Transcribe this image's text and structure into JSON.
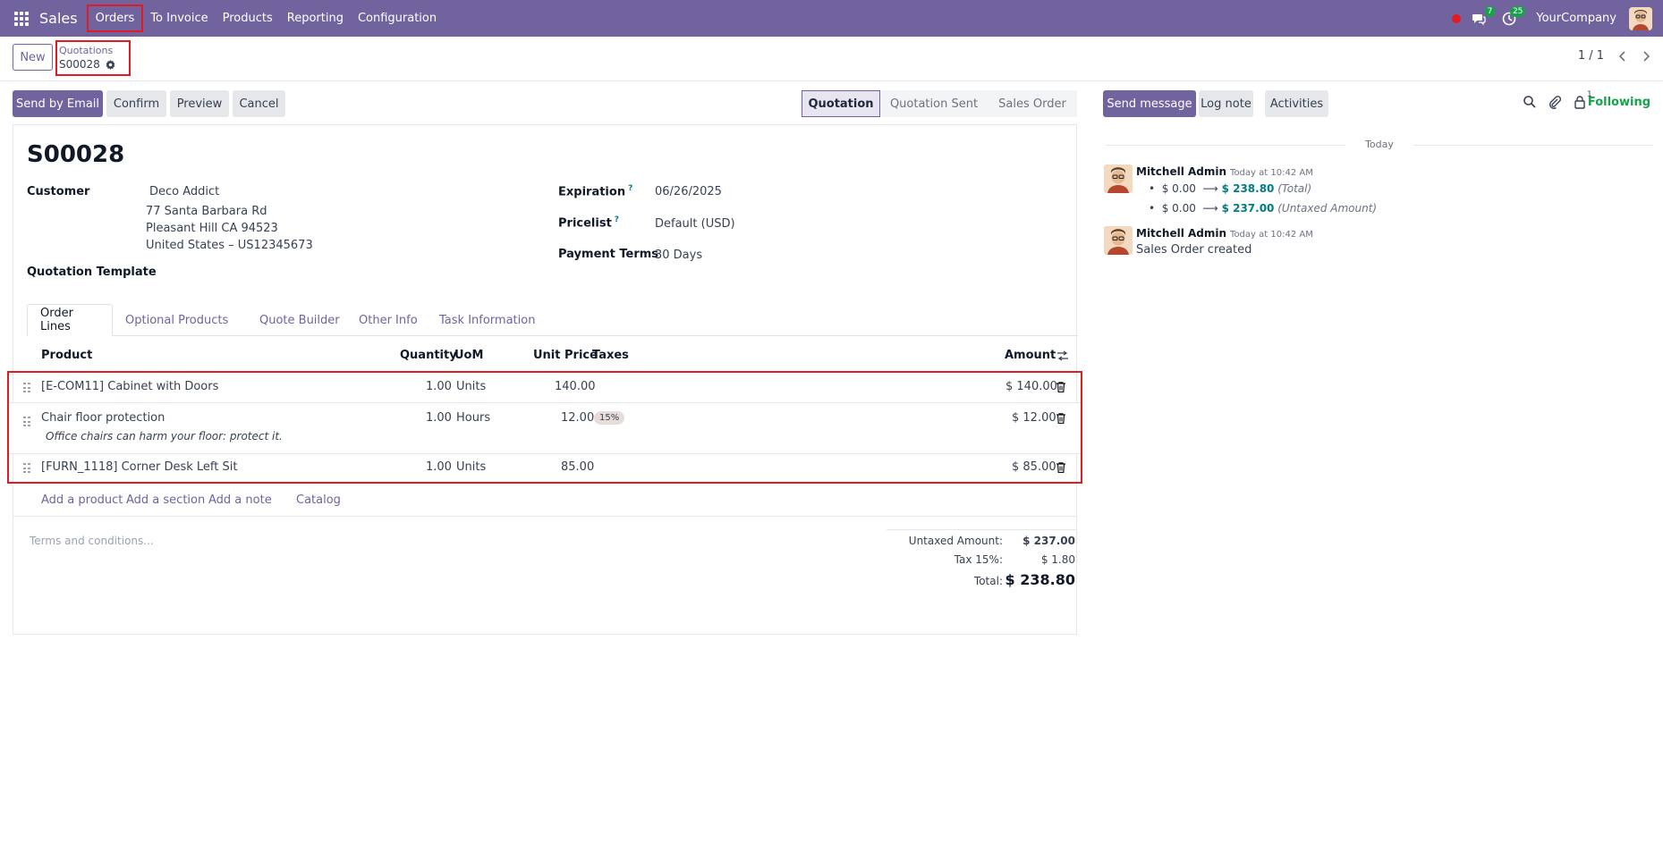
{
  "navbar": {
    "app_name": "Sales",
    "menu": [
      "Orders",
      "To Invoice",
      "Products",
      "Reporting",
      "Configuration"
    ],
    "messages_badge": "7",
    "activities_badge": "25",
    "company": "YourCompany"
  },
  "control": {
    "new_label": "New",
    "breadcrumb_parent": "Quotations",
    "breadcrumb_current": "S00028",
    "pager": "1 / 1"
  },
  "actions": {
    "send_email": "Send by Email",
    "confirm": "Confirm",
    "preview": "Preview",
    "cancel": "Cancel"
  },
  "status": {
    "stages": [
      "Quotation",
      "Quotation Sent",
      "Sales Order"
    ],
    "active": "Quotation"
  },
  "form": {
    "title": "S00028",
    "customer_label": "Customer",
    "customer_name": "Deco Addict",
    "address_line1": "77 Santa Barbara Rd",
    "address_line2": "Pleasant Hill CA 94523",
    "address_line3": "United States – US12345673",
    "template_label": "Quotation Template",
    "expiration_label": "Expiration",
    "expiration_value": "06/26/2025",
    "pricelist_label": "Pricelist",
    "pricelist_value": "Default (USD)",
    "payment_terms_label": "Payment Terms",
    "payment_terms_value": "30 Days",
    "help_mark": "?"
  },
  "tabs": [
    "Order Lines",
    "Optional Products",
    "Quote Builder",
    "Other Info",
    "Task Information"
  ],
  "lines": {
    "headers": {
      "product": "Product",
      "quantity": "Quantity",
      "uom": "UoM",
      "unit_price": "Unit Price",
      "taxes": "Taxes",
      "amount": "Amount"
    },
    "rows": [
      {
        "product": "[E-COM11] Cabinet with Doors",
        "quantity": "1.00",
        "uom": "Units",
        "unit_price": "140.00",
        "tax": "",
        "amount": "$ 140.00"
      },
      {
        "product": "Chair floor protection",
        "description": "Office chairs can harm your floor: protect it.",
        "quantity": "1.00",
        "uom": "Hours",
        "unit_price": "12.00",
        "tax": "15%",
        "amount": "$ 12.00"
      },
      {
        "product": "[FURN_1118] Corner Desk Left Sit",
        "quantity": "1.00",
        "uom": "Units",
        "unit_price": "85.00",
        "tax": "",
        "amount": "$ 85.00"
      }
    ],
    "add_product": "Add a product",
    "add_section": "Add a section",
    "add_note": "Add a note",
    "catalog": "Catalog"
  },
  "footer": {
    "terms_placeholder": "Terms and conditions...",
    "untaxed_label": "Untaxed Amount:",
    "untaxed_value": "$ 237.00",
    "tax_label": "Tax 15%:",
    "tax_value": "$ 1.80",
    "total_label": "Total:",
    "total_value": "$ 238.80"
  },
  "chatter": {
    "send_message": "Send message",
    "log_note": "Log note",
    "activities": "Activities",
    "followers_count": "1",
    "following": "Following",
    "today": "Today",
    "messages": [
      {
        "author": "Mitchell Admin",
        "time": "Today at 10:42 AM",
        "tracking": [
          {
            "old": "$ 0.00",
            "new": "$ 238.80",
            "field": "(Total)"
          },
          {
            "old": "$ 0.00",
            "new": "$ 237.00",
            "field": "(Untaxed Amount)"
          }
        ]
      },
      {
        "author": "Mitchell Admin",
        "time": "Today at 10:42 AM",
        "body": "Sales Order created"
      }
    ]
  },
  "colors": {
    "brand": "#71639e",
    "success": "#17a34a",
    "teal": "#017e84",
    "highlight_box": "#e01b24"
  }
}
